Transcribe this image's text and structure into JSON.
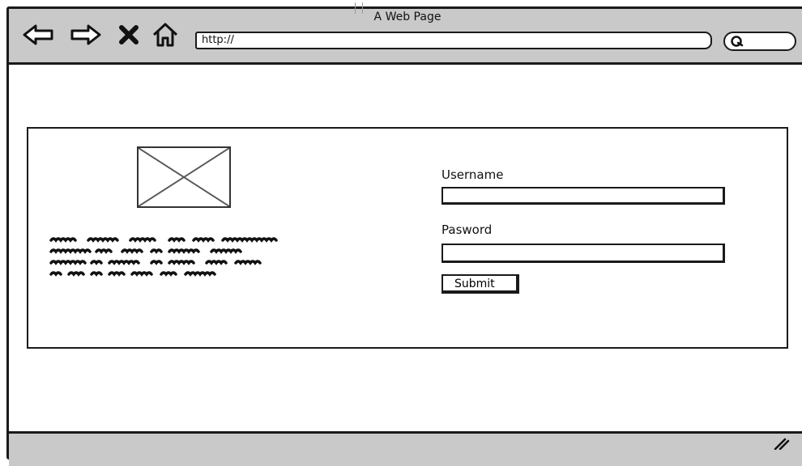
{
  "window": {
    "title": "A Web Page"
  },
  "toolbar": {
    "back_icon": "back-arrow-icon",
    "forward_icon": "forward-arrow-icon",
    "stop_icon": "close-icon",
    "home_icon": "home-icon",
    "url": "http://",
    "search_icon": "search-icon"
  },
  "login": {
    "username_label": "Username",
    "username_value": "",
    "password_label": "Pasword",
    "password_value": "",
    "submit_label": "Submit"
  },
  "colors": {
    "chrome": "#c9c9c9",
    "stroke": "#1a1a1a",
    "background": "#ffffff"
  }
}
